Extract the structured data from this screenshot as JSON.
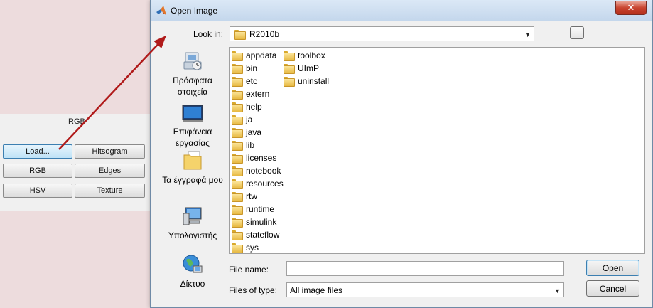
{
  "background_gui": {
    "rgb_label": "RGB",
    "buttons": {
      "load": "Load...",
      "histogram": "Hitsogram",
      "rgb": "RGB",
      "edges": "Edges",
      "hsv": "HSV",
      "texture": "Texture"
    }
  },
  "dialog": {
    "title": "Open Image",
    "close_label": "✕",
    "look_in_label": "Look in:",
    "look_in_value": "R2010b",
    "places": [
      {
        "label": "Πρόσφατα στοιχεία",
        "icon": "recent-items-icon"
      },
      {
        "label": "Επιφάνεια εργασίας",
        "icon": "desktop-icon"
      },
      {
        "label": "Τα έγγραφά μου",
        "icon": "documents-icon"
      },
      {
        "label": "Υπολογιστής",
        "icon": "computer-icon"
      },
      {
        "label": "Δίκτυο",
        "icon": "network-icon"
      }
    ],
    "files_col1": [
      "appdata",
      "bin",
      "etc",
      "extern",
      "help",
      "ja",
      "java",
      "lib",
      "licenses",
      "notebook",
      "resources",
      "rtw",
      "runtime",
      "simulink",
      "stateflow",
      "sys"
    ],
    "files_col2": [
      "toolbox",
      "UImP",
      "uninstall"
    ],
    "file_name_label": "File name:",
    "file_name_value": "",
    "file_type_label": "Files of type:",
    "file_type_value": "All image files",
    "open_label": "Open",
    "cancel_label": "Cancel"
  },
  "colors": {
    "axes_bg": "#eddcdd",
    "arrow": "#b01a1a",
    "close_red": "#c8442f"
  }
}
